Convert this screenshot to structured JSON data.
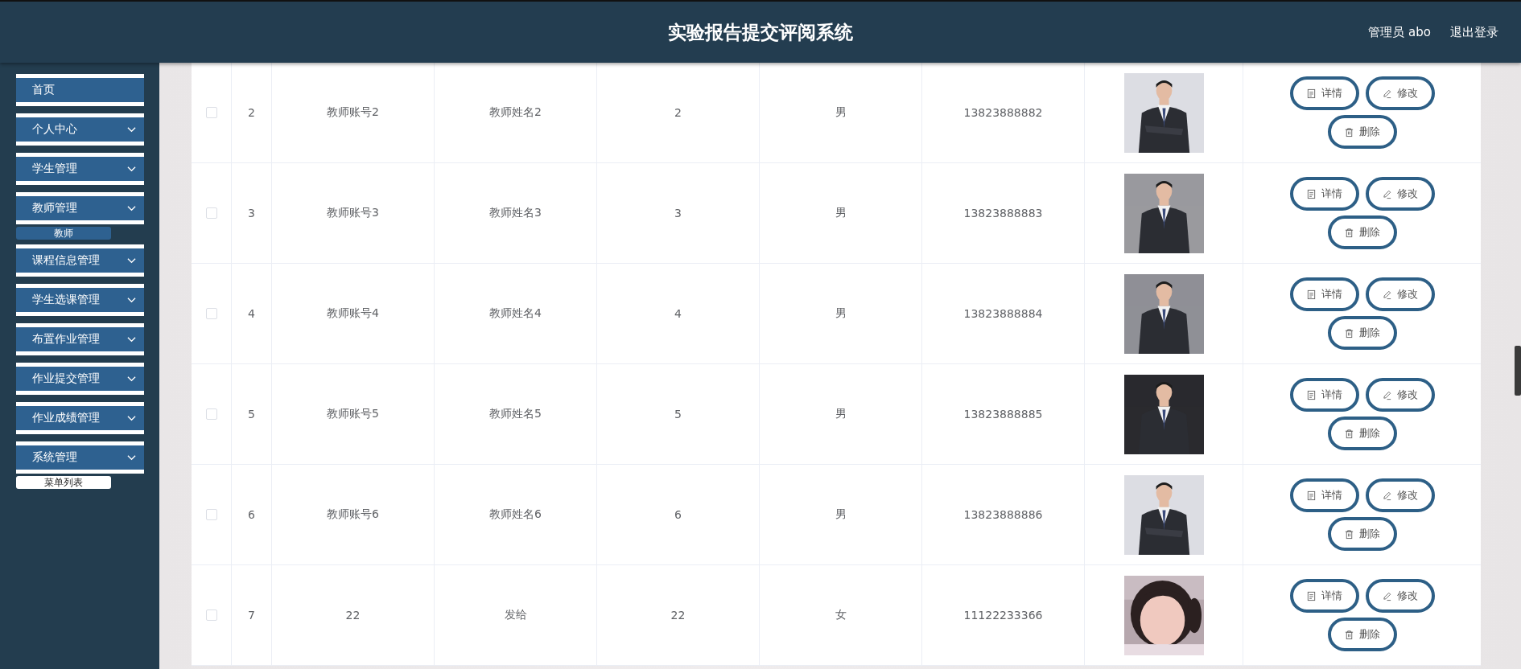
{
  "header": {
    "title": "实验报告提交评阅系统",
    "user": "管理员 abo",
    "logout": "退出登录"
  },
  "sidebar": {
    "items": [
      {
        "label": "首页",
        "kind": "link"
      },
      {
        "label": "个人中心",
        "kind": "menu"
      },
      {
        "label": "学生管理",
        "kind": "menu"
      },
      {
        "label": "教师管理",
        "kind": "menu",
        "children": [
          {
            "label": "教师",
            "selected": false
          }
        ]
      },
      {
        "label": "课程信息管理",
        "kind": "menu"
      },
      {
        "label": "学生选课管理",
        "kind": "menu"
      },
      {
        "label": "布置作业管理",
        "kind": "menu"
      },
      {
        "label": "作业提交管理",
        "kind": "menu"
      },
      {
        "label": "作业成绩管理",
        "kind": "menu"
      },
      {
        "label": "系统管理",
        "kind": "menu",
        "children": [
          {
            "label": "菜单列表",
            "selected": true
          }
        ]
      }
    ]
  },
  "table": {
    "rows": [
      {
        "checked": false,
        "cells": [
          "2",
          "教师账号2",
          "教师姓名2",
          "2",
          "男",
          "13823888882"
        ],
        "actions": [
          {
            "label": "详情",
            "kind": "detail"
          },
          {
            "label": "修改",
            "kind": "edit"
          },
          {
            "label": "删除",
            "kind": "delete"
          }
        ]
      },
      {
        "checked": false,
        "cells": [
          "3",
          "教师账号3",
          "教师姓名3",
          "3",
          "男",
          "13823888883"
        ],
        "actions": [
          {
            "label": "详情",
            "kind": "detail"
          },
          {
            "label": "修改",
            "kind": "edit"
          },
          {
            "label": "删除",
            "kind": "delete"
          }
        ]
      },
      {
        "checked": false,
        "cells": [
          "4",
          "教师账号4",
          "教师姓名4",
          "4",
          "男",
          "13823888884"
        ],
        "actions": [
          {
            "label": "详情",
            "kind": "detail"
          },
          {
            "label": "修改",
            "kind": "edit"
          },
          {
            "label": "删除",
            "kind": "delete"
          }
        ]
      },
      {
        "checked": false,
        "cells": [
          "5",
          "教师账号5",
          "教师姓名5",
          "5",
          "男",
          "13823888885"
        ],
        "actions": [
          {
            "label": "详情",
            "kind": "detail"
          },
          {
            "label": "修改",
            "kind": "edit"
          },
          {
            "label": "删除",
            "kind": "delete"
          }
        ]
      },
      {
        "checked": false,
        "cells": [
          "6",
          "教师账号6",
          "教师姓名6",
          "6",
          "男",
          "13823888886"
        ],
        "actions": [
          {
            "label": "详情",
            "kind": "detail"
          },
          {
            "label": "修改",
            "kind": "edit"
          },
          {
            "label": "删除",
            "kind": "delete"
          }
        ]
      },
      {
        "checked": false,
        "cells": [
          "7",
          "22",
          "发给",
          "22",
          "女",
          "11122233366"
        ],
        "actions": [
          {
            "label": "详情",
            "kind": "detail"
          },
          {
            "label": "修改",
            "kind": "edit"
          },
          {
            "label": "删除",
            "kind": "delete"
          }
        ]
      }
    ]
  }
}
